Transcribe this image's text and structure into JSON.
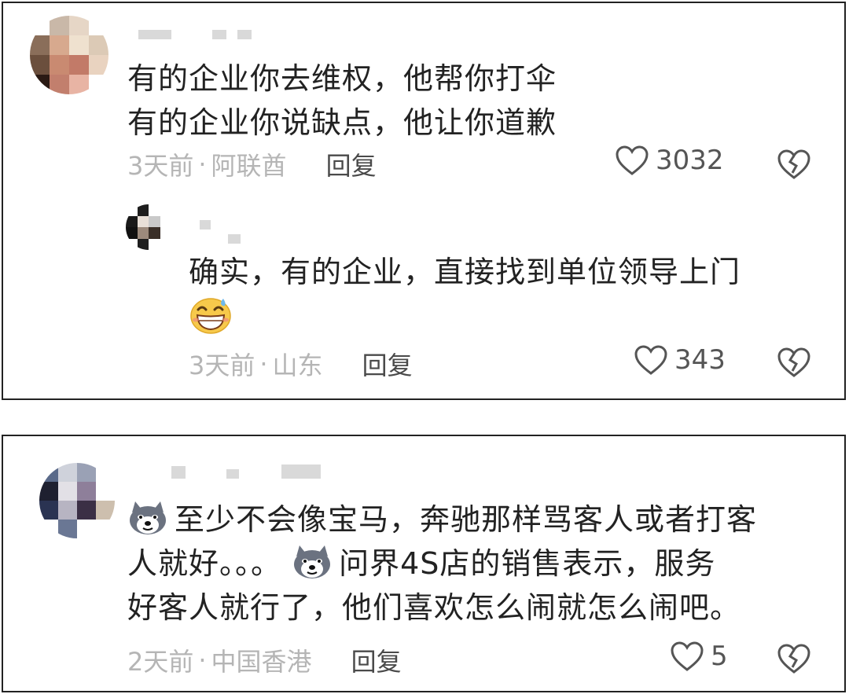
{
  "thread1": {
    "comment": {
      "line1": "有的企业你去维权，他帮你打伞",
      "line2": "有的企业你说缺点，他让你道歉",
      "time": "3天前",
      "sep": "·",
      "location": "阿联酋",
      "reply_label": "回复",
      "likes": "3032"
    },
    "reply": {
      "text": "确实，有的企业，直接找到单位领导上门",
      "emoji": "grinning-sweat-emoji",
      "time": "3天前",
      "sep": "·",
      "location": "山东",
      "reply_label": "回复",
      "likes": "343"
    }
  },
  "thread2": {
    "comment": {
      "line1_text": "至少不会像宝马，奔驰那样骂客人或者打客",
      "line2_part1": "人就好。。。",
      "line2_part2": "问界4S店的销售表示，服务",
      "line3": "好客人就行了，他们喜欢怎么闹就怎么闹吧。",
      "sticker": "husky-dog-sticker",
      "time": "2天前",
      "sep": "·",
      "location": "中国香港",
      "reply_label": "回复",
      "likes": "5"
    }
  },
  "colors": {
    "text": "#222222",
    "meta": "#b5b5b5",
    "icon": "#555555",
    "border": "#222222"
  }
}
